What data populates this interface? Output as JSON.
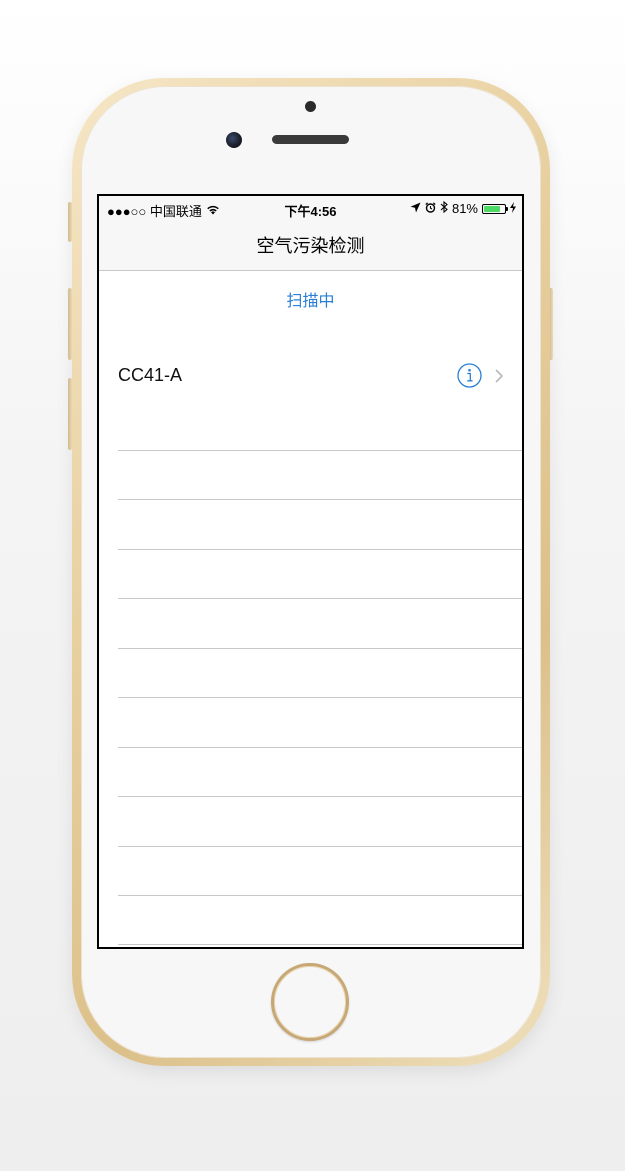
{
  "status_bar": {
    "carrier": "●●●○○ 中国联通",
    "time": "下午4:56",
    "battery_percent": "81%",
    "battery_level": 0.81
  },
  "nav": {
    "title": "空气污染检测"
  },
  "scan": {
    "status": "扫描中"
  },
  "devices": [
    {
      "name": "CC41-A"
    }
  ],
  "colors": {
    "accent": "#2a7fd4",
    "battery": "#4cd964",
    "separator": "#c8c7cc",
    "phone_gold": "#e7cf9e"
  },
  "icons": {
    "signal": "signal-dots-icon",
    "wifi": "wifi-icon",
    "location": "location-arrow-icon",
    "alarm": "alarm-icon",
    "bluetooth": "bluetooth-icon",
    "battery": "battery-icon",
    "charging": "charging-bolt-icon",
    "info": "info-icon",
    "disclosure": "chevron-right-icon"
  }
}
